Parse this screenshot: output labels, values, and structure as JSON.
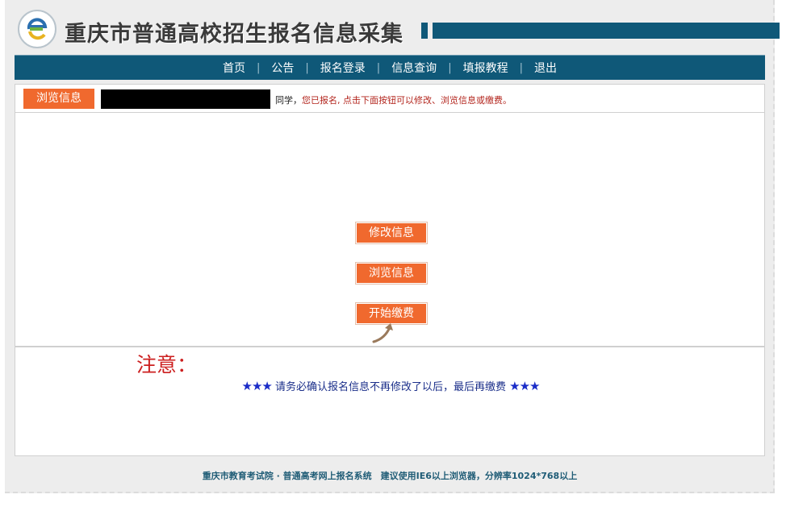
{
  "header": {
    "title": "重庆市普通高校招生报名信息采集",
    "brand_color": "#0f5878"
  },
  "nav": {
    "items": [
      {
        "label": "首页"
      },
      {
        "label": "公告"
      },
      {
        "label": "报名登录"
      },
      {
        "label": "信息查询"
      },
      {
        "label": "填报教程"
      },
      {
        "label": "退出"
      }
    ],
    "separator": "|"
  },
  "info": {
    "tag": "浏览信息",
    "classmate": "同学，",
    "message": "您已报名, 点击下面按钮可以修改、浏览信息或缴费。"
  },
  "actions": {
    "modify": "修改信息",
    "browse": "浏览信息",
    "pay": "开始缴费"
  },
  "notice": {
    "title": "注意：",
    "stars_left": "★★★",
    "text": "请务必确认报名信息不再修改了以后，最后再缴费",
    "stars_right": "★★★"
  },
  "footer": {
    "text": "重庆市教育考试院 · 普通高考网上报名系统　建议使用IE6以上浏览器，分辨率1024*768以上"
  },
  "colors": {
    "accent_orange": "#f0692e",
    "message_red": "#b3261e",
    "notice_red": "#cc1f1f",
    "star_blue": "#1a2cc8"
  },
  "icons": {
    "logo": "e-logo-icon",
    "cursor": "curved-arrow-icon"
  }
}
